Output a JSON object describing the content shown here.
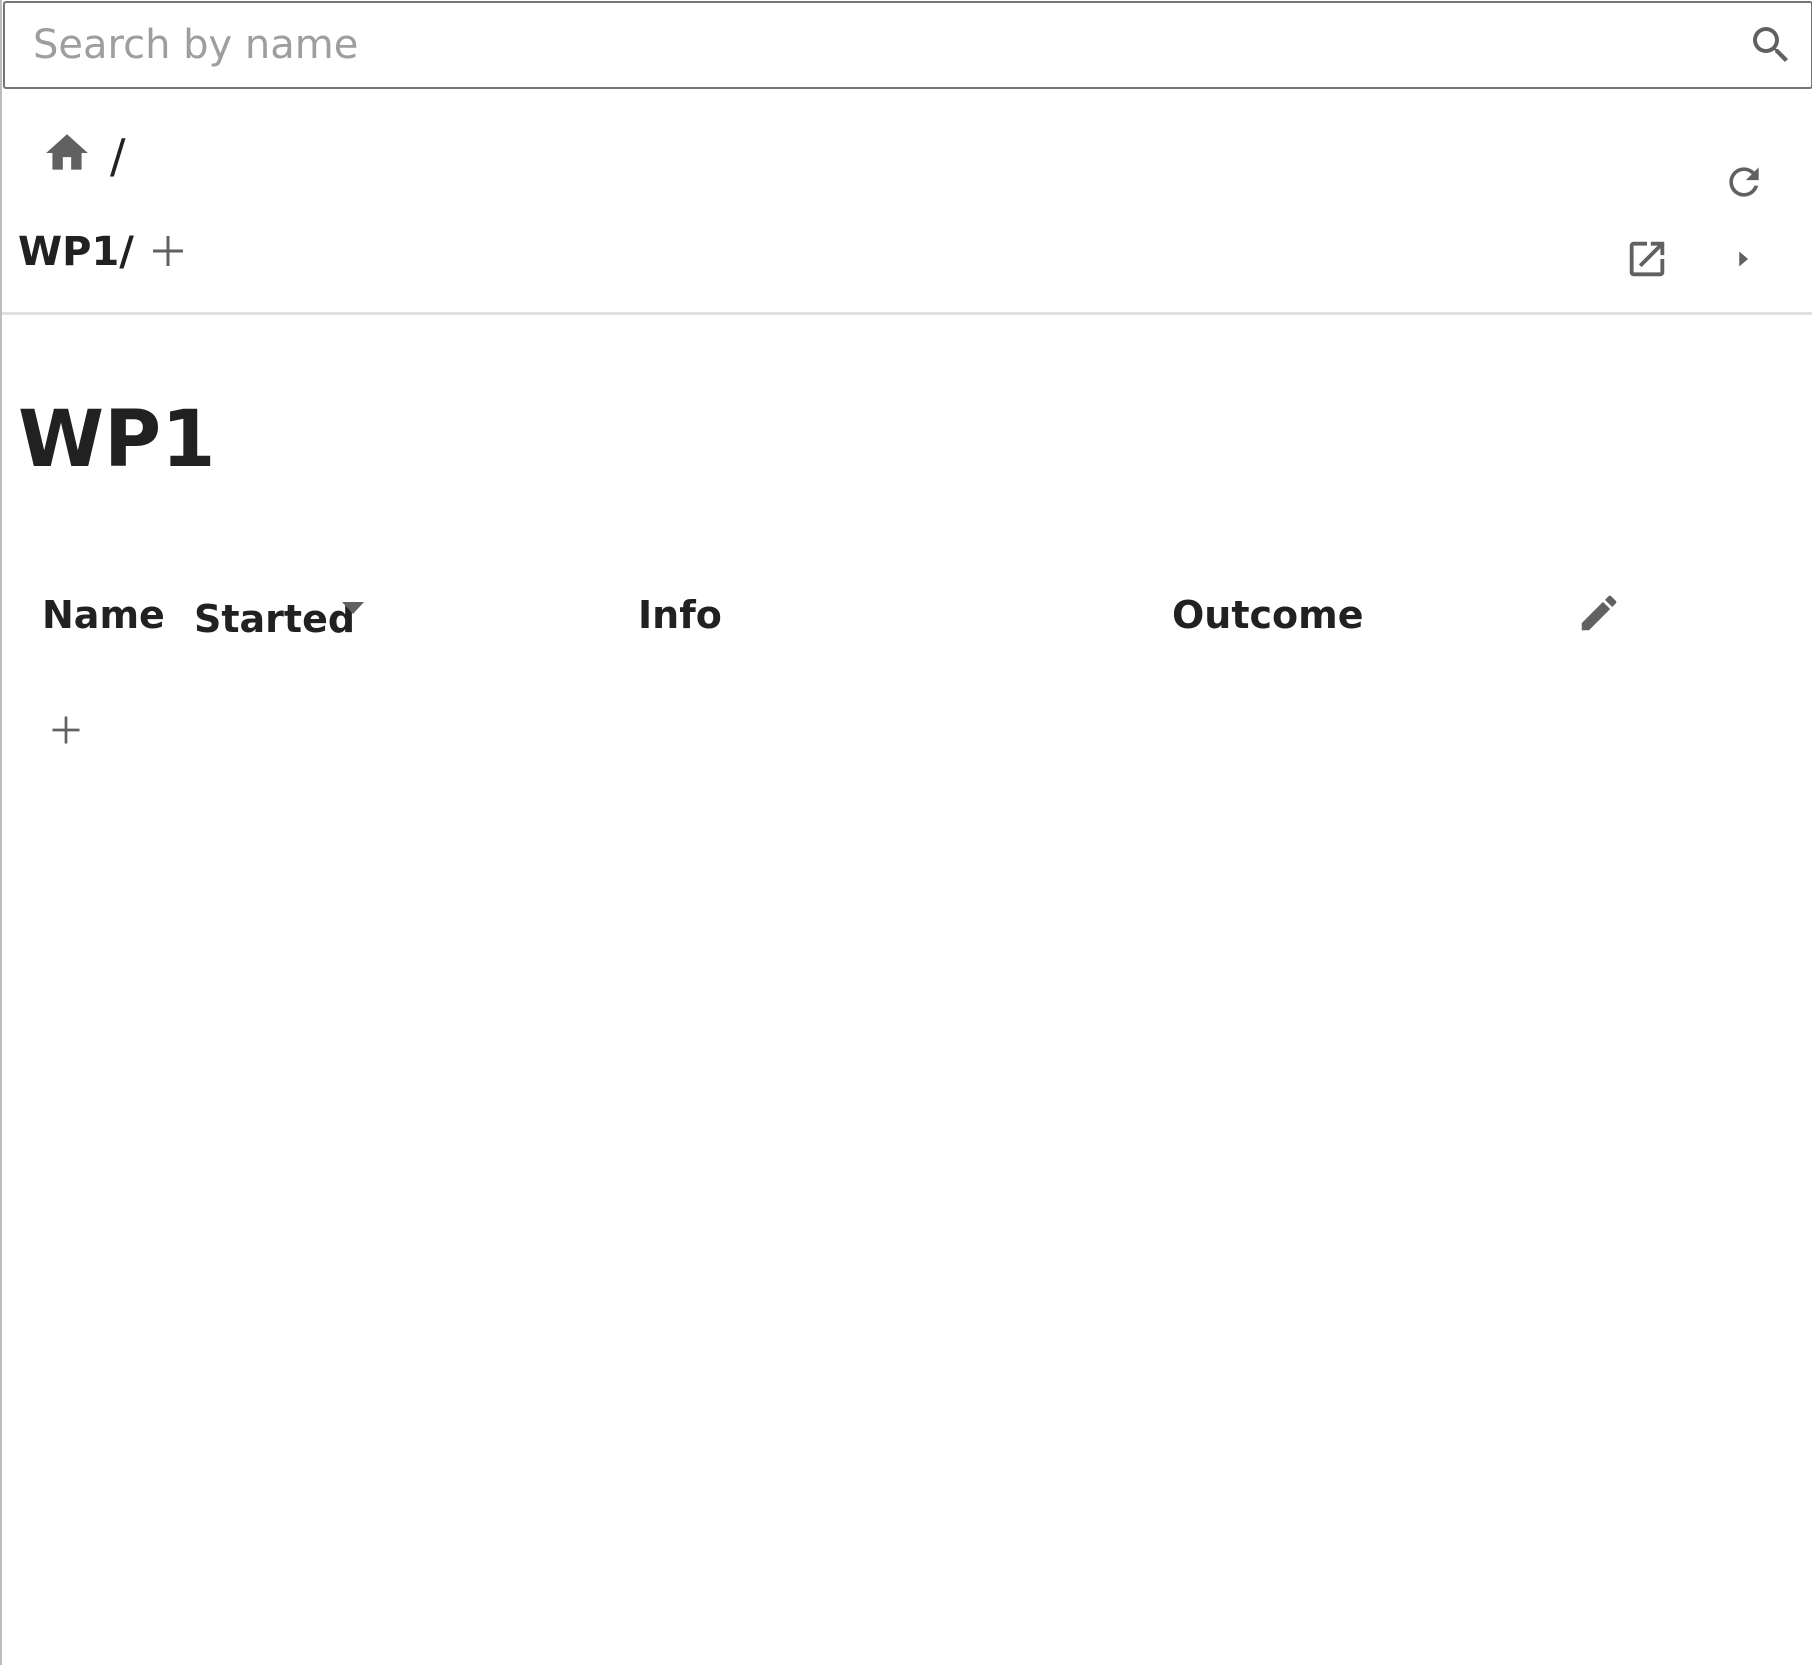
{
  "search": {
    "placeholder": "Search by name",
    "value": ""
  },
  "breadcrumb": {
    "separator": "/"
  },
  "path": {
    "label": "WP1/"
  },
  "page": {
    "title": "WP1"
  },
  "table": {
    "columns": {
      "name": "Name",
      "started": "Started",
      "info": "Info",
      "outcome": "Outcome"
    },
    "sort_column": "Started",
    "sort_direction": "descending",
    "rows": []
  },
  "colors": {
    "text": "#212121",
    "icon": "#616161",
    "placeholder": "#9e9e9e",
    "divider": "#e0e0e0",
    "search_border": "#757575"
  },
  "icons": [
    "search-icon",
    "home-icon",
    "add-icon",
    "refresh-icon",
    "open-external-icon",
    "chevron-right-icon",
    "sort-down-icon",
    "edit-icon"
  ]
}
